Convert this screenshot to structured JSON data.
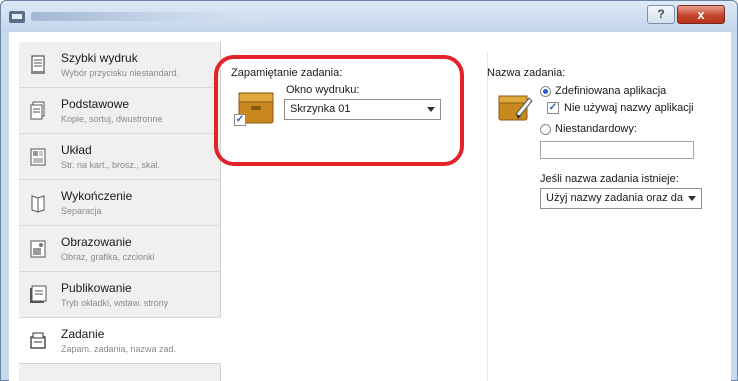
{
  "window": {
    "help_label": "?",
    "close_label": "x",
    "icon": "printer-icon"
  },
  "nav": {
    "items": [
      {
        "title": "Szybki wydruk",
        "subtitle": "Wybór przycisku niestandard.",
        "icon": "quick-print-icon"
      },
      {
        "title": "Podstawowe",
        "subtitle": "Kopie, sortuj, dwustronne",
        "icon": "basic-icon"
      },
      {
        "title": "Układ",
        "subtitle": "Str. na kart., brosz., skal.",
        "icon": "layout-icon"
      },
      {
        "title": "Wykończenie",
        "subtitle": "Separacja",
        "icon": "finishing-icon"
      },
      {
        "title": "Obrazowanie",
        "subtitle": "Obraz, grafika, czcionki",
        "icon": "imaging-icon"
      },
      {
        "title": "Publikowanie",
        "subtitle": "Tryb okładki, wstaw. strony",
        "icon": "publishing-icon"
      },
      {
        "title": "Zadanie",
        "subtitle": "Zapam. zadania, nazwa zad.",
        "icon": "job-icon"
      }
    ],
    "active_index": 6
  },
  "job_storage": {
    "label": "Zapamiętanie zadania:",
    "checked": true,
    "icon": "job-storage-box-icon",
    "output_label": "Okno wydruku:",
    "output_value": "Skrzynka 01"
  },
  "job_name": {
    "label": "Nazwa zadania:",
    "icon": "job-name-folder-icon",
    "radio_defined": "Zdefiniowana aplikacja",
    "checkbox_no_app_name": "Nie używaj nazwy aplikacji",
    "radio_custom": "Niestandardowy:",
    "custom_value": "",
    "exists_label": "Jeśli nazwa zadania istnieje:",
    "exists_value": "Użyj nazwy zadania oraz da"
  },
  "colors": {
    "highlight": "#e3232a",
    "radio_accent": "#2a63c8",
    "nav_background": "#f0f0f0"
  }
}
